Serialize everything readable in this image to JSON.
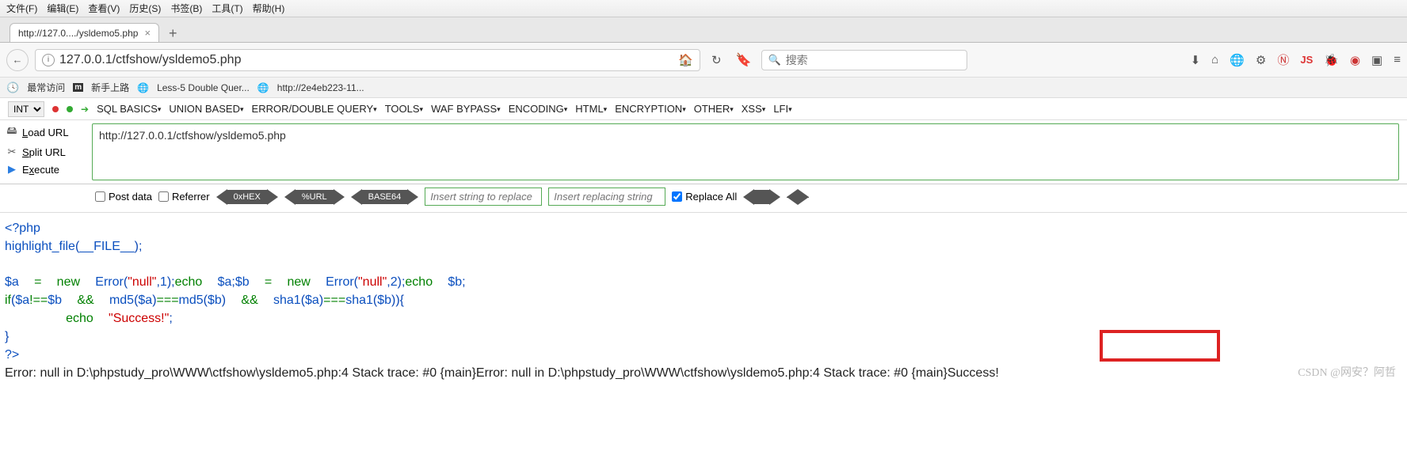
{
  "menu": [
    "文件(F)",
    "编辑(E)",
    "查看(V)",
    "历史(S)",
    "书签(B)",
    "工具(T)",
    "帮助(H)"
  ],
  "tab": {
    "title": "http://127.0..../ysldemo5.php"
  },
  "address": {
    "url": "127.0.0.1/ctfshow/ysldemo5.php"
  },
  "search": {
    "placeholder": "搜索"
  },
  "bookmarks": {
    "most": "最常访问",
    "newbie": "新手上路",
    "less5": "Less-5 Double Quer...",
    "ext": "http://2e4eb223-11..."
  },
  "hackbar": {
    "select": "INT",
    "menus": [
      "SQL BASICS",
      "UNION BASED",
      "ERROR/DOUBLE QUERY",
      "TOOLS",
      "WAF BYPASS",
      "ENCODING",
      "HTML",
      "ENCRYPTION",
      "OTHER",
      "XSS",
      "LFI"
    ],
    "load": "Load URL",
    "split": "Split URL",
    "exec": "Execute",
    "url": "http://127.0.0.1/ctfshow/ysldemo5.php",
    "post": "Post data",
    "referrer": "Referrer",
    "hex": "0xHEX",
    "purl": "%URL",
    "b64": "BASE64",
    "repl_from_ph": "Insert string to replace",
    "repl_to_ph": "Insert replacing string",
    "repl_all": "Replace All"
  },
  "code": {
    "l1a": "<?php",
    "l2_fn": "highlight_file",
    "l2_arg": "__FILE__",
    "l4_a": "$a",
    "l4_b": "$b",
    "l4_new": "new",
    "l4_err": "Error",
    "l4_null": "\"null\"",
    "l4_one": "1",
    "l4_two": "2",
    "l4_echo": "echo",
    "l5_if": "if",
    "l5_md5": "md5",
    "l5_sha1": "sha1",
    "l5_and": "&&",
    "l6_echo": "echo",
    "l6_s": "\"Success!\"",
    "l8": "?>"
  },
  "error_line": "Error: null in D:\\phpstudy_pro\\WWW\\ctfshow\\ysldemo5.php:4 Stack trace: #0 {main}Error: null in D:\\phpstudy_pro\\WWW\\ctfshow\\ysldemo5.php:4 Stack trace: #0 {main}Success!",
  "watermark": "CSDN @网安？阿哲"
}
